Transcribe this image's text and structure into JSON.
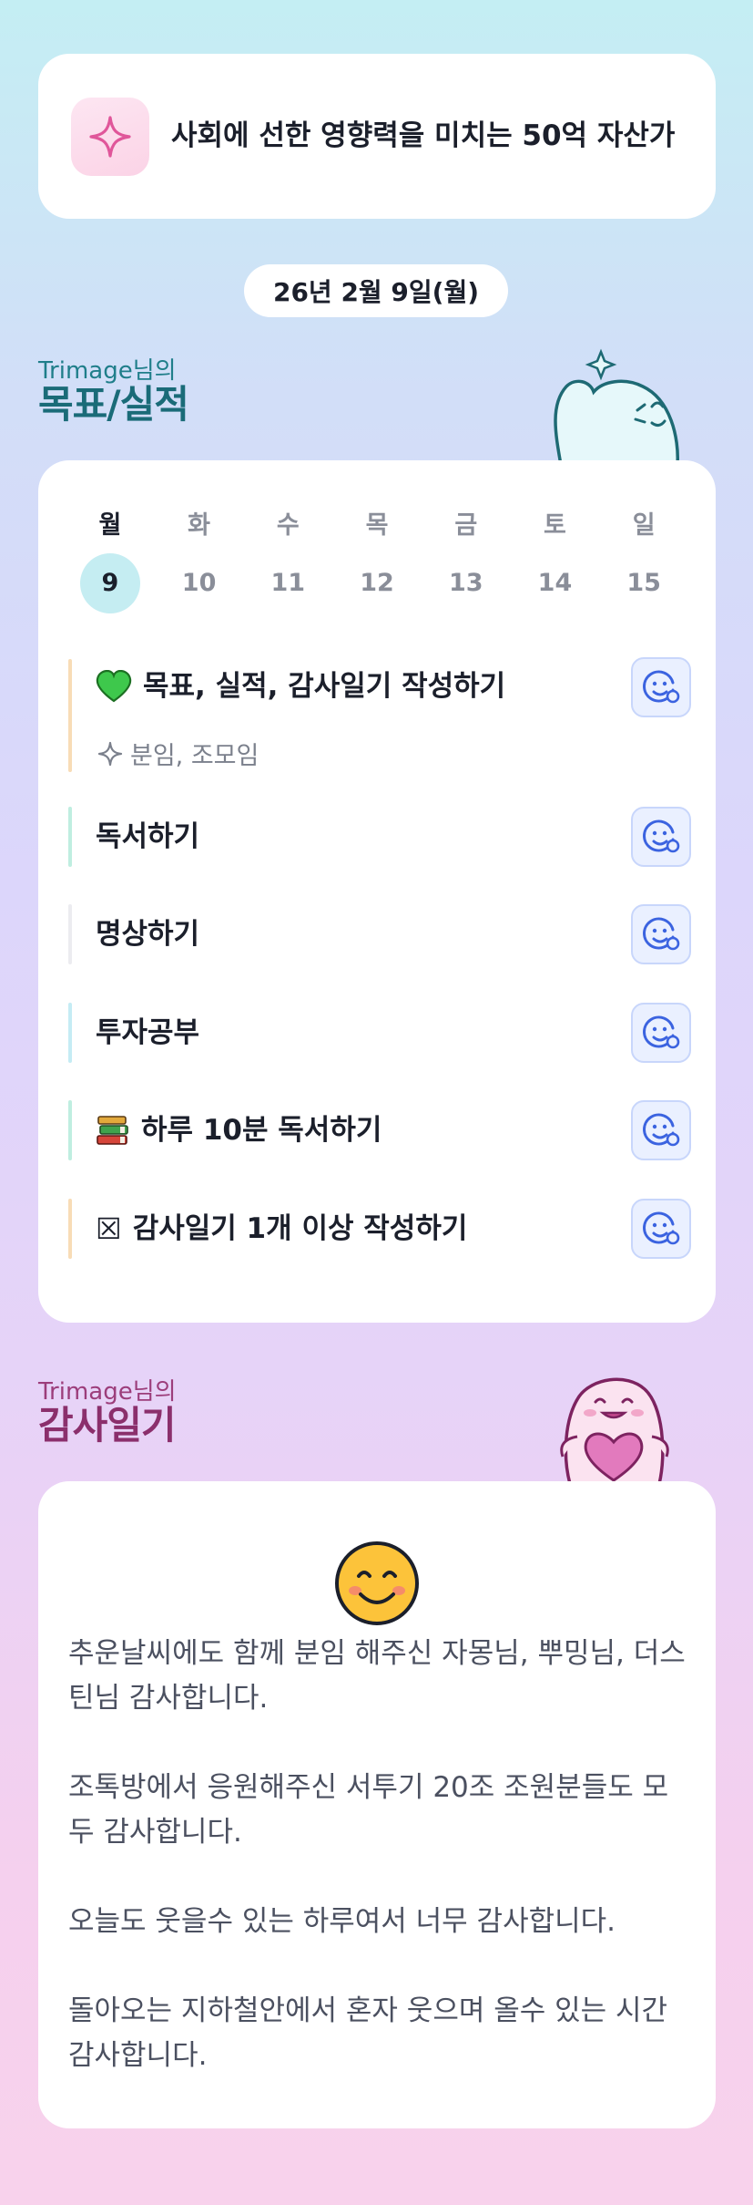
{
  "goal": {
    "text": "사회에 선한 영향력을 미치는 50억 자산가",
    "icon": "sparkle-icon"
  },
  "date_label": "26년 2월 9일(월)",
  "goals_section": {
    "who": "Trimage님의",
    "title": "목표/실적"
  },
  "week": [
    {
      "dow": "월",
      "num": "9",
      "active": true
    },
    {
      "dow": "화",
      "num": "10"
    },
    {
      "dow": "수",
      "num": "11"
    },
    {
      "dow": "목",
      "num": "12"
    },
    {
      "dow": "금",
      "num": "13"
    },
    {
      "dow": "토",
      "num": "14"
    },
    {
      "dow": "일",
      "num": "15"
    }
  ],
  "tasks": [
    {
      "label": "목표, 실적, 감사일기 작성하기",
      "emoji": "green-heart-icon",
      "sub": "분임, 조모임",
      "bar_color": "#f8dcb6"
    },
    {
      "label": "독서하기",
      "bar_color": "#bfeee0"
    },
    {
      "label": "명상하기",
      "bar_color": "#ececf0"
    },
    {
      "label": "투자공부",
      "bar_color": "#c5ecf4"
    },
    {
      "label": "하루 10분 독서하기",
      "emoji": "books-icon",
      "bar_color": "#bfeee0"
    },
    {
      "label": "감사일기 1개 이상 작성하기",
      "emoji": "ballot-box-x-icon",
      "prefix": "☒",
      "bar_color": "#f8dcb6"
    }
  ],
  "thanks_section": {
    "who": "Trimage님의",
    "title": "감사일기"
  },
  "thanks": {
    "emoji": "smiling-face-icon",
    "text": "추운날씨에도 함께 분임 해주신 자몽님, 뿌밍님, 더스틴님 감사합니다.\n\n조톡방에서 응원해주신 서투기 20조 조원분들도 모두 감사합니다.\n\n오늘도 웃을수 있는 하루여서 너무 감사합니다.\n\n돌아오는 지하철안에서 혼자 웃으며 올수 있는 시간 감사합니다."
  },
  "colors": {
    "accent": "#c5edf2",
    "goals_title": "#1a6b78",
    "thanks_title": "#8b2f6c"
  }
}
